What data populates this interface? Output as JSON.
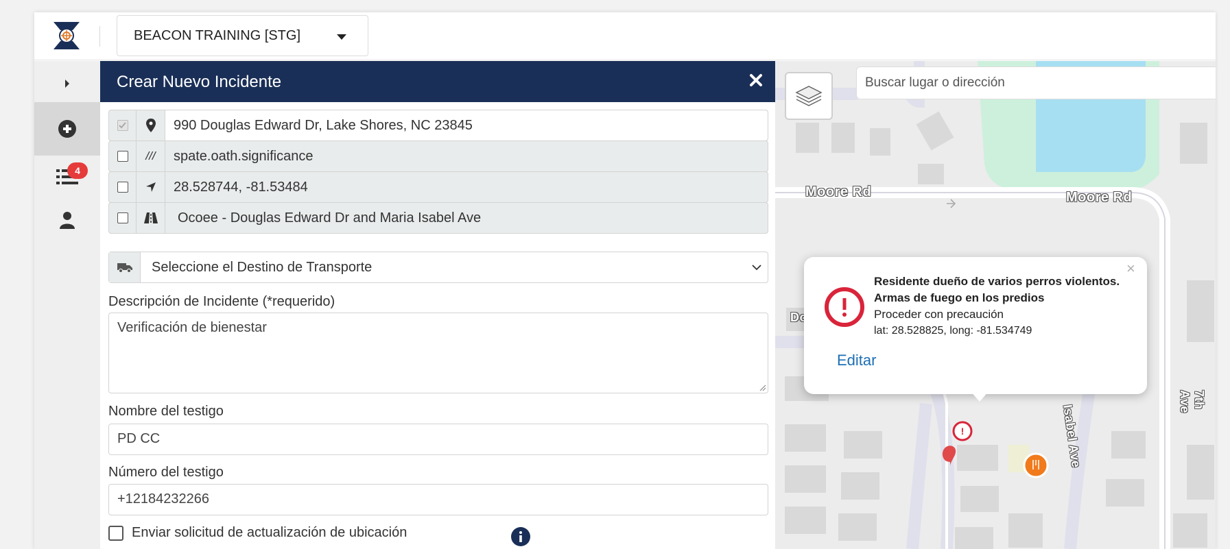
{
  "topbar": {
    "org_name": "BEACON TRAINING [STG]"
  },
  "rail": {
    "list_badge": "4"
  },
  "panel": {
    "title": "Crear Nuevo Incidente",
    "address": "990 Douglas Edward Dr, Lake Shores, NC 23845",
    "what3words": "spate.oath.significance",
    "coordinates": "28.528744, -81.53484",
    "intersection": "Ocoee -  Douglas Edward Dr and Maria Isabel Ave",
    "transport_placeholder": "Seleccione el Destino de Transporte",
    "description_label": "Descripción de Incidente (*requerido)",
    "description_value": "Verificación de bienestar",
    "witness_name_label": "Nombre del testigo",
    "witness_name_value": "PD CC",
    "witness_number_label": "Número del testigo",
    "witness_number_value": "+12184232266",
    "send_update_label": "Enviar solicitud de actualización de ubicación"
  },
  "map": {
    "search_placeholder": "Buscar lugar o dirección",
    "road_labels": {
      "moore_rd_left": "Moore Rd",
      "moore_rd_right": "Moore Rd",
      "do_partial": "Do",
      "isabel_ave": "Isabel Ave",
      "seventh_ave": "7th Ave"
    },
    "popup": {
      "title": "Residente dueño de varios perros violentos. Armas de fuego en los predios",
      "subtitle": "Proceder con precaución",
      "coords": "lat: 28.528825, long: -81.534749",
      "edit_label": "Editar",
      "close_glyph": "×"
    }
  },
  "colors": {
    "header_navy": "#1a2f57",
    "alert_red": "#d9243a",
    "badge_red": "#e63b3b",
    "link_blue": "#1c6fb5",
    "water": "#a7dff2",
    "park": "#cdf0dc"
  },
  "icons": {
    "logo": "beacon-logo",
    "expand": "caret-right-icon",
    "create": "plus-circle-icon",
    "list": "list-icon",
    "user": "user-icon",
    "close": "close-icon",
    "address": "map-marker-icon",
    "w3w": "slashes-icon",
    "coords": "location-arrow-icon",
    "intersection": "road-icon",
    "transport": "truck-icon",
    "info": "info-circle-icon",
    "layers": "layers-icon"
  }
}
